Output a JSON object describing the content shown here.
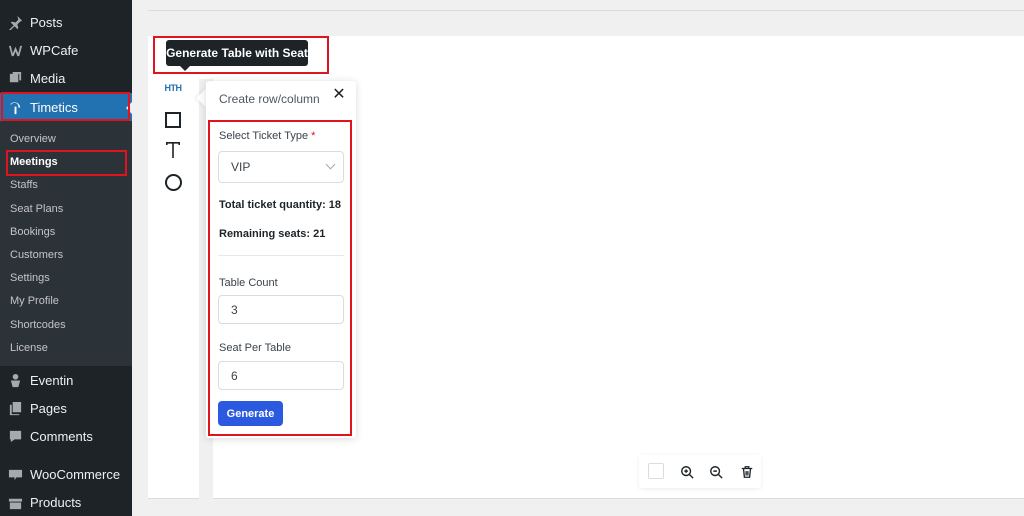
{
  "sidebar": {
    "items": [
      {
        "label": "Posts",
        "icon": "pin-icon"
      },
      {
        "label": "WPCafe",
        "icon": "wpcafe-icon"
      },
      {
        "label": "Media",
        "icon": "media-icon"
      },
      {
        "label": "Timetics",
        "icon": "timetics-icon"
      },
      {
        "label": "Eventin",
        "icon": "eventin-icon"
      },
      {
        "label": "Pages",
        "icon": "pages-icon"
      },
      {
        "label": "Comments",
        "icon": "comments-icon"
      },
      {
        "label": "WooCommerce",
        "icon": "woocommerce-icon"
      },
      {
        "label": "Products",
        "icon": "products-icon"
      }
    ],
    "submenu": [
      {
        "label": "Overview"
      },
      {
        "label": "Meetings"
      },
      {
        "label": "Staffs"
      },
      {
        "label": "Seat Plans"
      },
      {
        "label": "Bookings"
      },
      {
        "label": "Customers"
      },
      {
        "label": "Settings"
      },
      {
        "label": "My Profile"
      },
      {
        "label": "Shortcodes"
      },
      {
        "label": "License"
      }
    ]
  },
  "tooltip": {
    "text": "Generate Table with Seat"
  },
  "tools": {
    "table_label": "HTH"
  },
  "panel": {
    "title": "Create row/column",
    "close": "✕",
    "ticket_type_label": "Select Ticket Type",
    "required": "*",
    "ticket_type_value": "VIP",
    "total_quantity": "Total ticket quantity: 18",
    "remaining_seats": "Remaining seats: 21",
    "table_count_label": "Table Count",
    "table_count_value": "3",
    "seat_per_table_label": "Seat Per Table",
    "seat_per_table_value": "6",
    "generate_label": "Generate"
  },
  "colors": {
    "sidebar_bg": "#1d2327",
    "active": "#2271b1",
    "highlight": "#e0141e",
    "primary_button": "#2b59e0"
  }
}
